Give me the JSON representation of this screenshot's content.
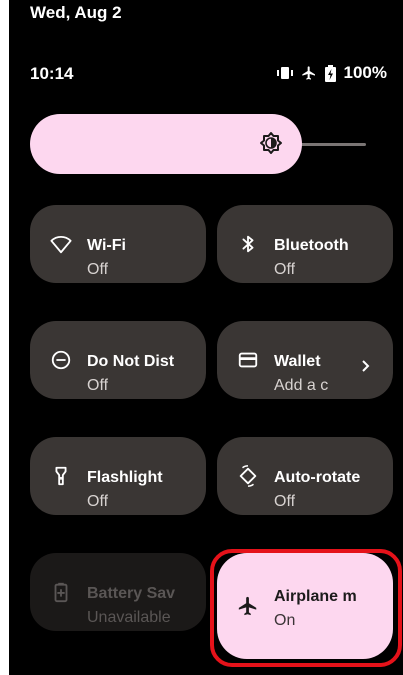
{
  "status": {
    "date": "Wed, Aug 2",
    "time": "10:14",
    "battery": "100%"
  },
  "brightness": {
    "level": 0.82,
    "icon": "brightness-icon"
  },
  "tiles": [
    {
      "title": "Wi-Fi",
      "sub": "Off",
      "icon": "wifi-icon",
      "state": "off"
    },
    {
      "title": "Bluetooth",
      "sub": "Off",
      "icon": "bluetooth-icon",
      "state": "off"
    },
    {
      "title": "Do Not Dist",
      "sub": "Off",
      "icon": "dnd-icon",
      "state": "off"
    },
    {
      "title": "Wallet",
      "sub": "Add a c",
      "icon": "wallet-icon",
      "state": "off"
    },
    {
      "title": "Flashlight",
      "sub": "Off",
      "icon": "flashlight-icon",
      "state": "off"
    },
    {
      "title": "Auto-rotate",
      "sub": "Off",
      "icon": "auto-rotate-icon",
      "state": "off"
    },
    {
      "title": "Battery Sav",
      "sub": "Unavailable",
      "icon": "battery-saver-icon",
      "state": "unavailable"
    },
    {
      "title": "Airplane m",
      "sub": "On",
      "icon": "airplane-icon",
      "state": "on"
    }
  ],
  "colors": {
    "accent": "#fdd7ef",
    "tile_off": "#3a3634",
    "tile_unavailable": "#1b1918",
    "highlight": "#e5121a"
  }
}
